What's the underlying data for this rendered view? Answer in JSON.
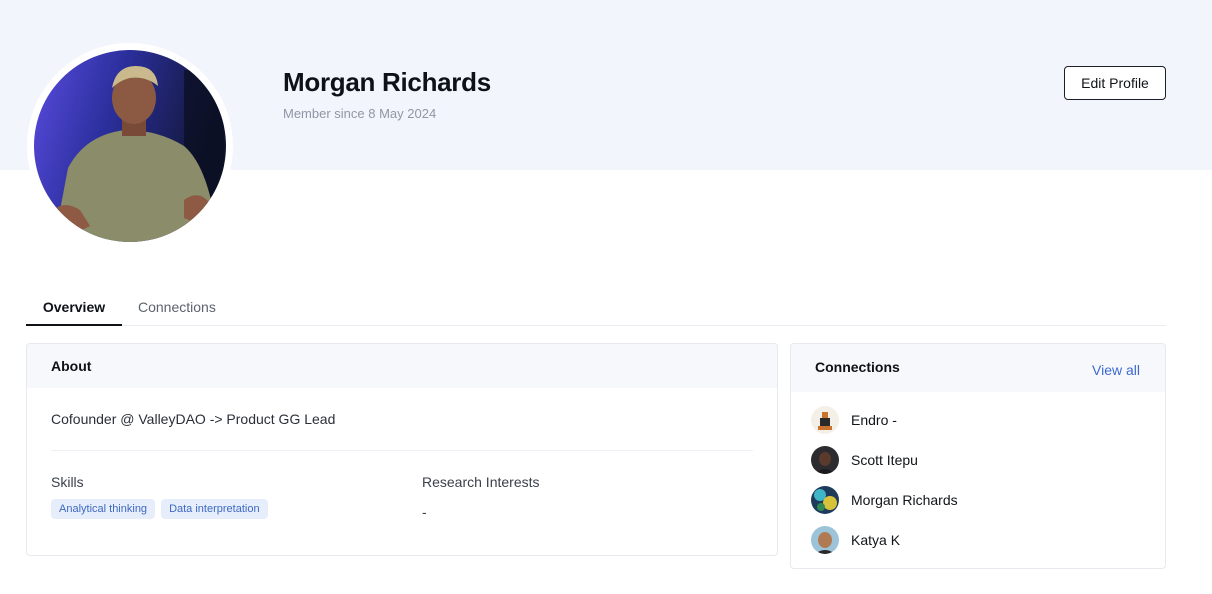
{
  "profile": {
    "name": "Morgan Richards",
    "member_since": "Member since 8 May 2024",
    "edit_label": "Edit Profile"
  },
  "tabs": [
    {
      "label": "Overview",
      "active": true
    },
    {
      "label": "Connections",
      "active": false
    }
  ],
  "about": {
    "title": "About",
    "bio": "Cofounder @ ValleyDAO -> Product GG Lead",
    "skills_label": "Skills",
    "skills": [
      "Analytical thinking",
      "Data interpretation"
    ],
    "interests_label": "Research Interests",
    "interests_value": "-"
  },
  "connections": {
    "title": "Connections",
    "view_all": "View all",
    "items": [
      {
        "name": "Endro -"
      },
      {
        "name": "Scott Itepu"
      },
      {
        "name": "Morgan Richards"
      },
      {
        "name": "Katya K"
      }
    ]
  },
  "colors": {
    "banner": "#f2f5fc",
    "link": "#3d6bd1",
    "tag_bg": "#e7eefb",
    "tag_text": "#3d68c2"
  }
}
